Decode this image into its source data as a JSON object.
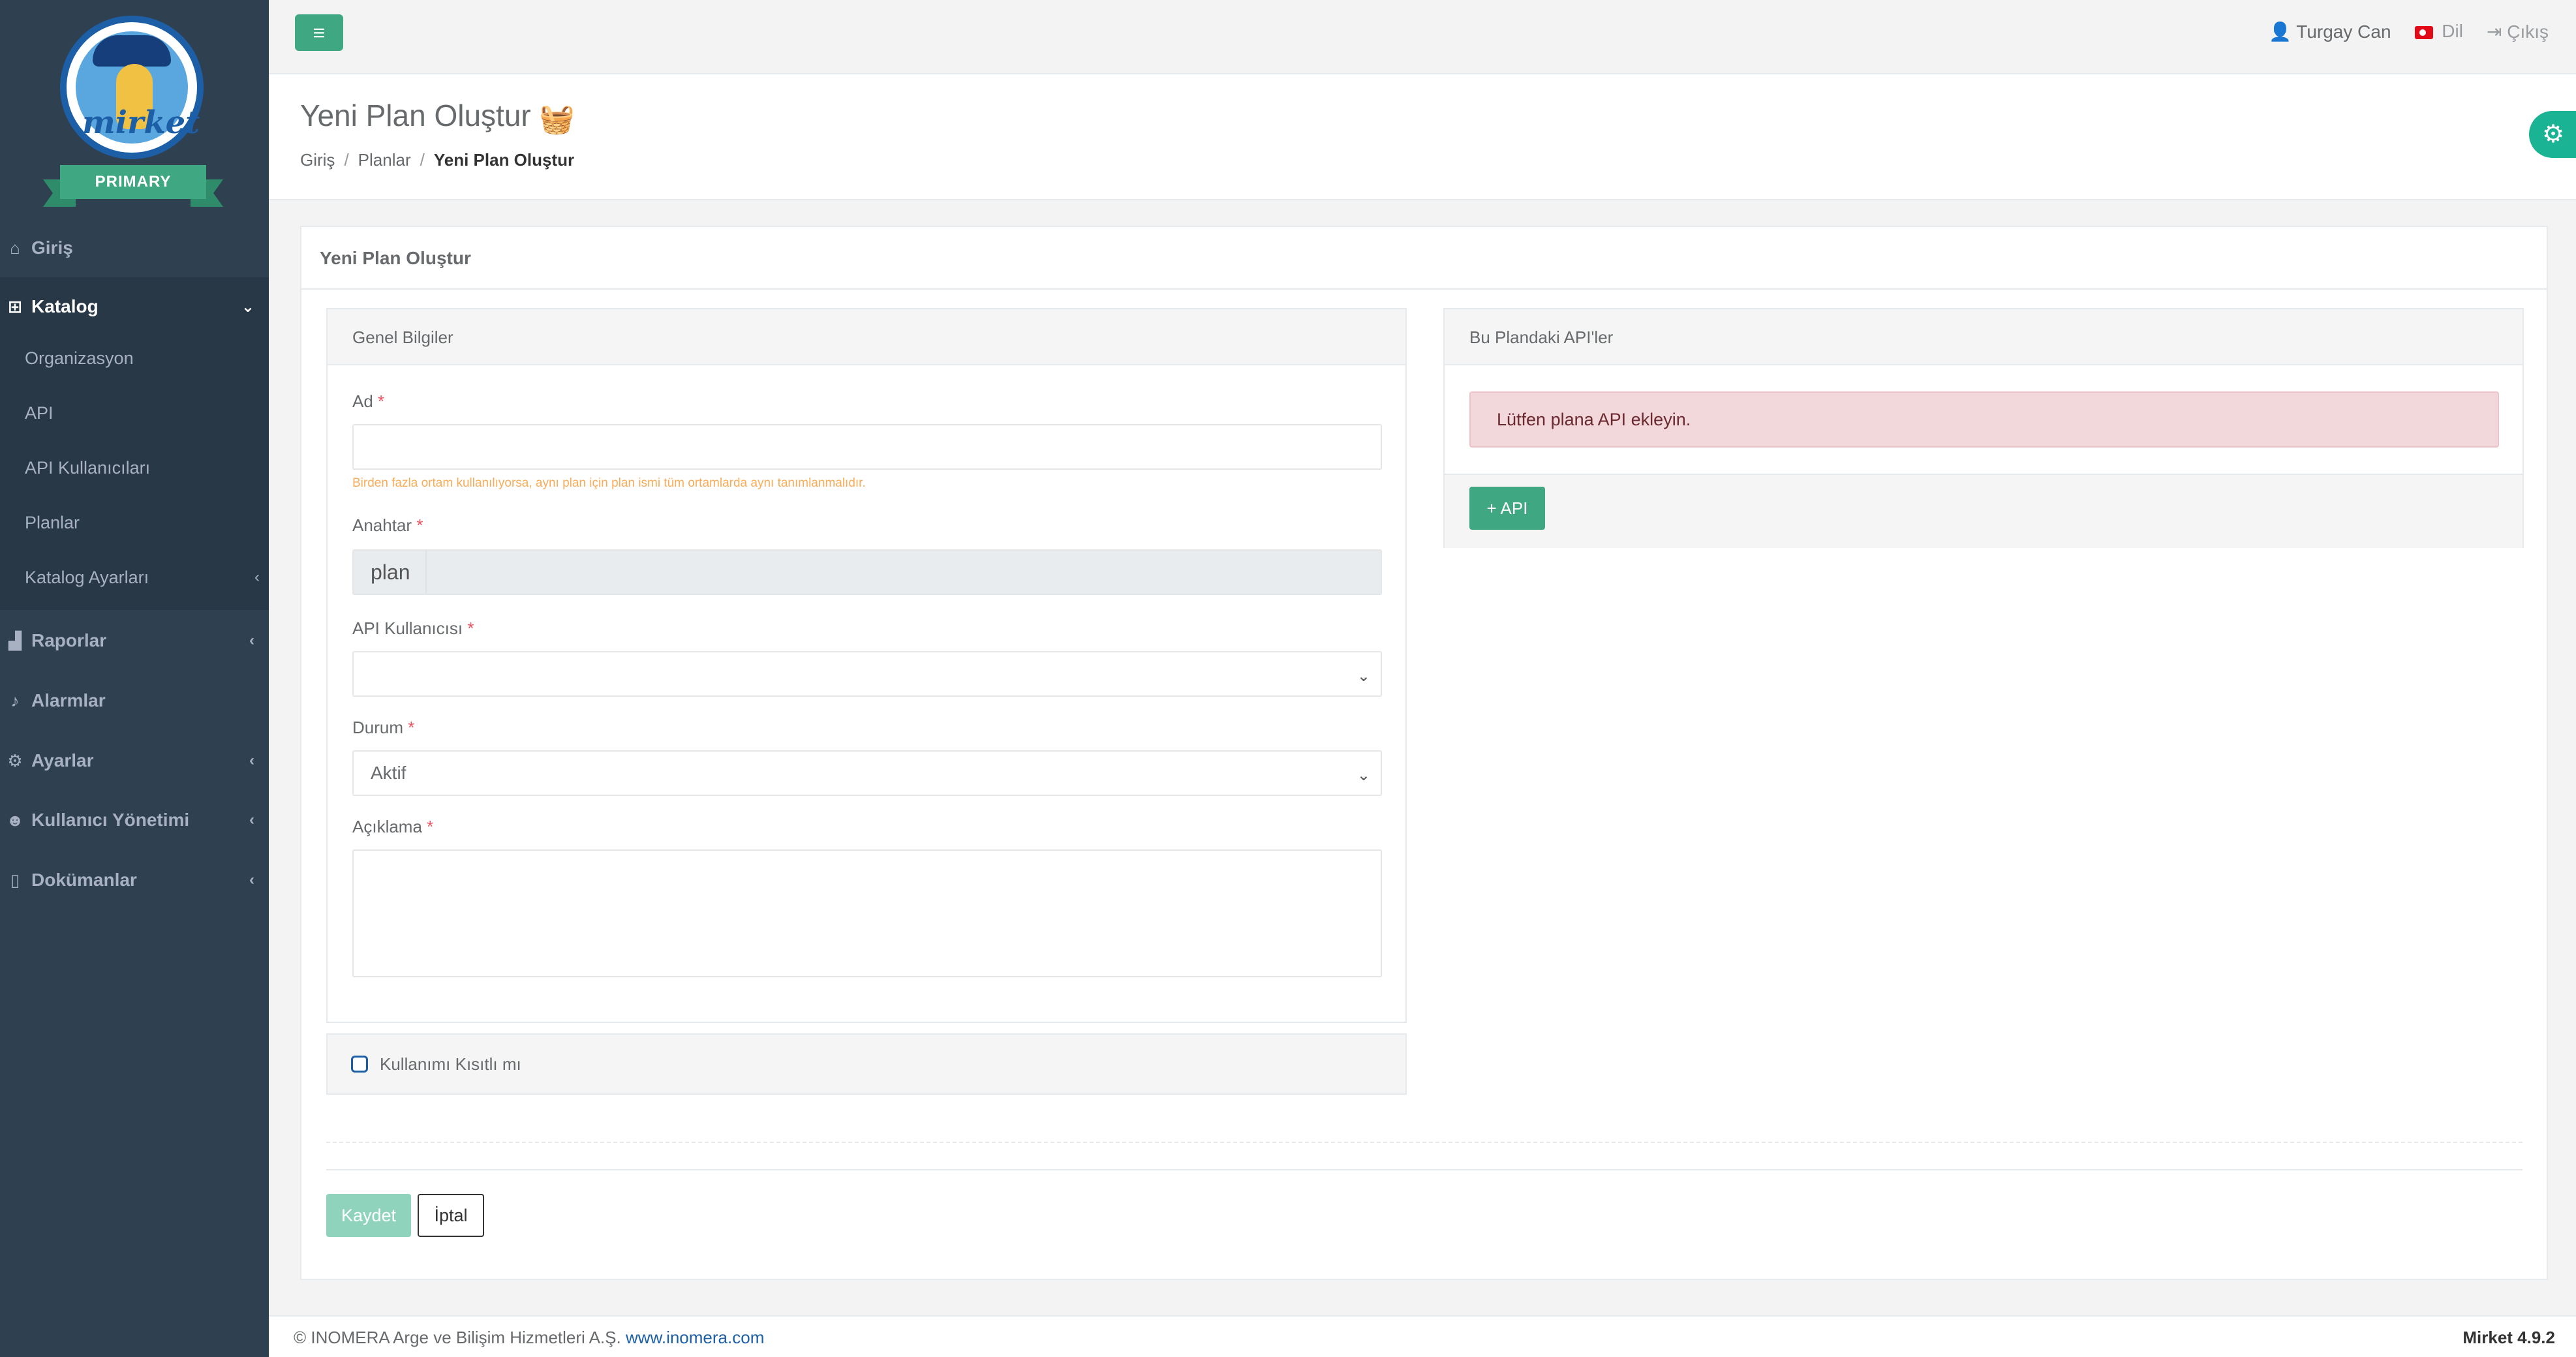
{
  "brand": {
    "logo_text": "mirket",
    "ribbon": "PRIMARY"
  },
  "sidebar": {
    "items": [
      {
        "label": "Giriş",
        "icon": "home-icon"
      },
      {
        "label": "Katalog",
        "icon": "sitemap-icon",
        "expanded": true,
        "children": [
          "Organizasyon",
          "API",
          "API Kullanıcıları",
          "Planlar",
          "Katalog Ayarları"
        ]
      },
      {
        "label": "Raporlar",
        "icon": "chart-icon"
      },
      {
        "label": "Alarmlar",
        "icon": "bell-icon"
      },
      {
        "label": "Ayarlar",
        "icon": "cogs-icon"
      },
      {
        "label": "Kullanıcı Yönetimi",
        "icon": "users-icon"
      },
      {
        "label": "Dokümanlar",
        "icon": "file-icon"
      }
    ]
  },
  "topbar": {
    "menu_icon": "bars-icon",
    "user": "Turgay Can",
    "language": "Dil",
    "logout": "Çıkış"
  },
  "heading": {
    "title": "Yeni Plan Oluştur",
    "breadcrumb": [
      "Giriş",
      "Planlar",
      "Yeni Plan Oluştur"
    ]
  },
  "form": {
    "box_title": "Yeni Plan Oluştur",
    "general": {
      "title": "Genel Bilgiler",
      "name_label": "Ad",
      "name_value": "",
      "name_hint": "Birden fazla ortam kullanılıyorsa, aynı plan için plan ismi tüm ortamlarda aynı tanımlanmalıdır.",
      "key_label": "Anahtar",
      "key_prefix": "plan",
      "api_user_label": "API Kullanıcısı",
      "api_user_value": "",
      "status_label": "Durum",
      "status_value": "Aktif",
      "description_label": "Açıklama",
      "description_value": ""
    },
    "restricted_label": "Kullanımı Kısıtlı mı",
    "restricted_checked": false,
    "apis": {
      "title": "Bu Plandaki API'ler",
      "alert": "Lütfen plana API ekleyin.",
      "add_button": "API"
    },
    "save_label": "Kaydet",
    "cancel_label": "İptal"
  },
  "footer": {
    "copyright": "© INOMERA Arge ve Bilişim Hizmetleri A.Ş.",
    "link": "www.inomera.com",
    "version": "Mirket 4.9.2"
  },
  "colors": {
    "sidebar_bg": "#2f4050",
    "accent": "#3fa882",
    "alert_bg": "#f2d7db",
    "required": "#ed5565",
    "hint": "#f8ac59"
  }
}
